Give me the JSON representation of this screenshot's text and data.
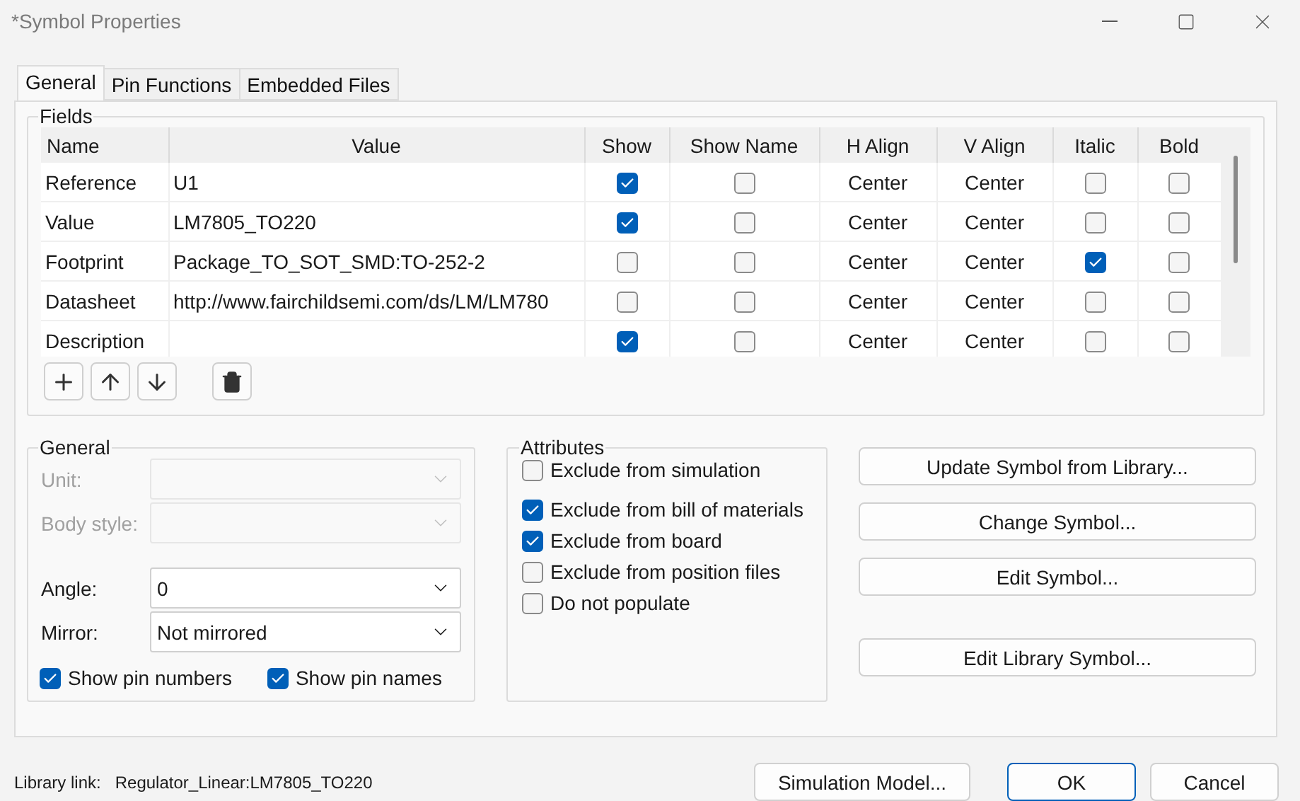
{
  "window": {
    "title": "*Symbol Properties"
  },
  "tabs": [
    {
      "label": "General",
      "selected": true
    },
    {
      "label": "Pin Functions",
      "selected": false
    },
    {
      "label": "Embedded Files",
      "selected": false
    }
  ],
  "fields": {
    "title": "Fields",
    "columns": [
      "Name",
      "Value",
      "Show",
      "Show Name",
      "H Align",
      "V Align",
      "Italic",
      "Bold"
    ],
    "rows": [
      {
        "name": "Reference",
        "value": "U1",
        "show": true,
        "show_name": false,
        "h_align": "Center",
        "v_align": "Center",
        "italic": false,
        "bold": false
      },
      {
        "name": "Value",
        "value": "LM7805_TO220",
        "show": true,
        "show_name": false,
        "h_align": "Center",
        "v_align": "Center",
        "italic": false,
        "bold": false
      },
      {
        "name": "Footprint",
        "value": "Package_TO_SOT_SMD:TO-252-2",
        "show": false,
        "show_name": false,
        "h_align": "Center",
        "v_align": "Center",
        "italic": true,
        "bold": false
      },
      {
        "name": "Datasheet",
        "value": "http://www.fairchildsemi.com/ds/LM/LM780",
        "show": false,
        "show_name": false,
        "h_align": "Center",
        "v_align": "Center",
        "italic": false,
        "bold": false
      },
      {
        "name": "Description",
        "value": "",
        "show": true,
        "show_name": false,
        "h_align": "Center",
        "v_align": "Center",
        "italic": false,
        "bold": false
      }
    ]
  },
  "general": {
    "title": "General",
    "selects": [
      {
        "label": "Unit:",
        "disabled": true
      },
      {
        "label": "Body style:",
        "disabled": true
      },
      {
        "label": "Angle:",
        "value": "0",
        "disabled": false
      },
      {
        "label": "Mirror:",
        "value": "Not mirrored",
        "disabled": false
      }
    ],
    "checks": [
      {
        "label": "Show pin numbers",
        "checked": true
      },
      {
        "label": "Show pin names",
        "checked": true
      }
    ]
  },
  "attributes": {
    "title": "Attributes",
    "groups": [
      [
        {
          "label": "Exclude from simulation",
          "checked": false
        }
      ],
      [
        {
          "label": "Exclude from bill of materials",
          "checked": true
        },
        {
          "label": "Exclude from board",
          "checked": true
        },
        {
          "label": "Exclude from position files",
          "checked": false
        },
        {
          "label": "Do not populate",
          "checked": false
        }
      ]
    ]
  },
  "actions": [
    [
      "Update Symbol from Library...",
      "Change Symbol...",
      "Edit Symbol..."
    ],
    [
      "Edit Library Symbol..."
    ]
  ],
  "footer": {
    "library_link": {
      "label": "Library link:",
      "value": "Regulator_Linear:LM7805_TO220"
    },
    "buttons": [
      {
        "label": "Simulation Model...",
        "default": false
      },
      {
        "label": "OK",
        "default": true
      },
      {
        "label": "Cancel",
        "default": false
      }
    ]
  }
}
